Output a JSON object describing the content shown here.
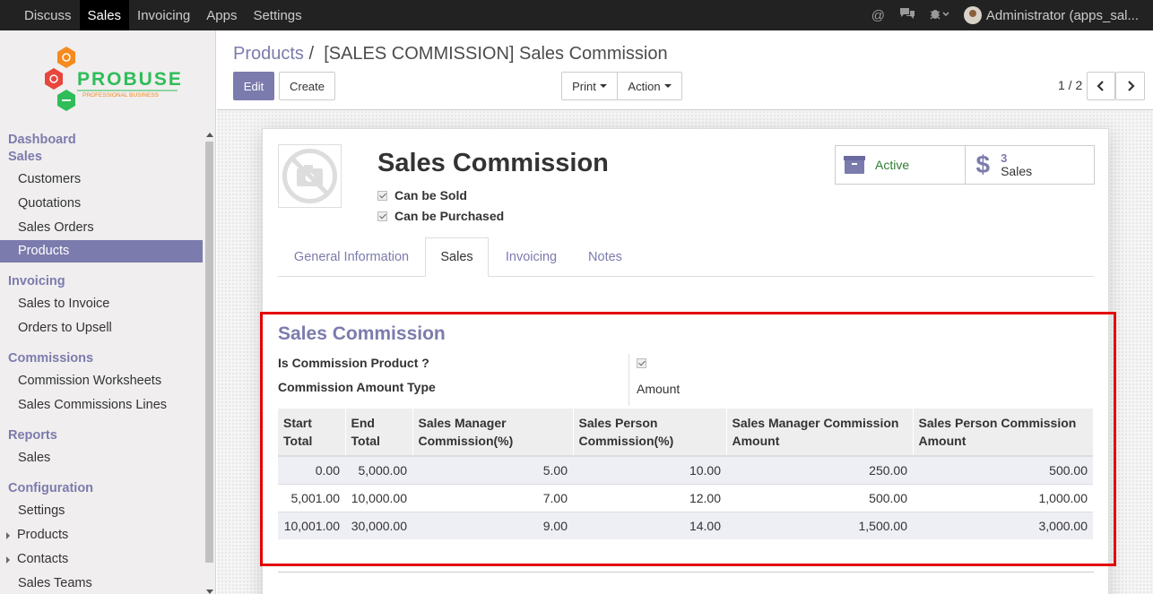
{
  "topbar": {
    "nav": [
      "Discuss",
      "Sales",
      "Invoicing",
      "Apps",
      "Settings"
    ],
    "active": "Sales",
    "user": "Administrator (apps_sal..."
  },
  "logo": {
    "name": "PROBUSE",
    "tagline": "PROFESSIONAL BUSINESS"
  },
  "sidebar": {
    "dashboard": "Dashboard",
    "sales": {
      "title": "Sales",
      "items": [
        "Customers",
        "Quotations",
        "Sales Orders",
        "Products"
      ]
    },
    "invoicing": {
      "title": "Invoicing",
      "items": [
        "Sales to Invoice",
        "Orders to Upsell"
      ]
    },
    "commissions": {
      "title": "Commissions",
      "items": [
        "Commission Worksheets",
        "Sales Commissions Lines"
      ]
    },
    "reports": {
      "title": "Reports",
      "items": [
        "Sales"
      ]
    },
    "configuration": {
      "title": "Configuration",
      "items": [
        "Settings",
        "Products",
        "Contacts",
        "Sales Teams"
      ]
    }
  },
  "breadcrumb": {
    "parent": "Products",
    "separator": "/",
    "current": "[SALES COMMISSION] Sales Commission"
  },
  "buttons": {
    "edit": "Edit",
    "create": "Create",
    "print": "Print",
    "action": "Action"
  },
  "pager": "1 / 2",
  "product": {
    "name": "Sales Commission",
    "can_be_sold": "Can be Sold",
    "can_be_purchased": "Can be Purchased"
  },
  "stats": {
    "active": "Active",
    "sales_count": "3",
    "sales_label": "Sales"
  },
  "tabs": [
    "General Information",
    "Sales",
    "Invoicing",
    "Notes"
  ],
  "active_tab": "Sales",
  "commission": {
    "title": "Sales Commission",
    "is_commission_label": "Is Commission Product ?",
    "amount_type_label": "Commission Amount Type",
    "amount_type_value": "Amount",
    "columns": [
      {
        "line1": "Start",
        "line2": "Total"
      },
      {
        "line1": "End",
        "line2": "Total"
      },
      {
        "line1": "Sales Manager",
        "line2": "Commission(%)"
      },
      {
        "line1": "Sales Person",
        "line2": "Commission(%)"
      },
      {
        "line1": "Sales Manager Commission",
        "line2": "Amount"
      },
      {
        "line1": "Sales Person Commission",
        "line2": "Amount"
      }
    ],
    "rows": [
      [
        "0.00",
        "5,000.00",
        "5.00",
        "10.00",
        "250.00",
        "500.00"
      ],
      [
        "5,001.00",
        "10,000.00",
        "7.00",
        "12.00",
        "500.00",
        "1,000.00"
      ],
      [
        "10,001.00",
        "30,000.00",
        "9.00",
        "14.00",
        "1,500.00",
        "3,000.00"
      ]
    ]
  },
  "colors": {
    "accent": "#7c7bad",
    "highlight": "#e30000",
    "topbar": "#222222",
    "active_green": "#2e7d32"
  }
}
